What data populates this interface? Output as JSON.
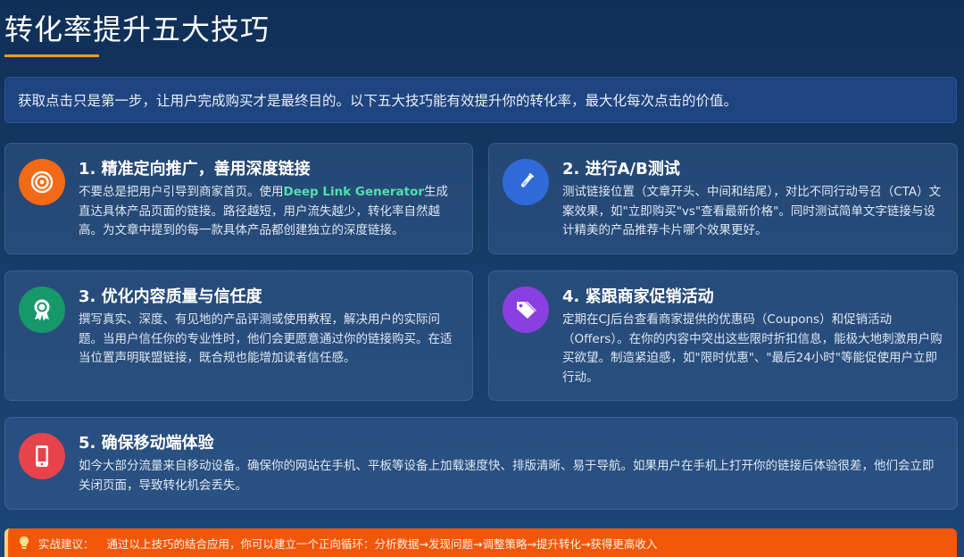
{
  "header": {
    "title": "转化率提升五大技巧"
  },
  "intro": "获取点击只是第一步，让用户完成购买才是最终目的。以下五大技巧能有效提升你的转化率，最大化每次点击的价值。",
  "colors": {
    "accent": "#f59a22",
    "tip_bar": "#f2560b",
    "highlight": "#4fe0b0"
  },
  "cards": [
    {
      "icon": "target-icon",
      "color": "#f26a16",
      "title": "1. 精准定向推广，善用深度链接",
      "body_pre": "不要总是把用户引导到商家首页。使用",
      "body_highlight": "Deep Link Generator",
      "body_post": "生成直达具体产品页面的链接。路径越短，用户流失越少，转化率自然越高。为文章中提到的每一款具体产品都创建独立的深度链接。"
    },
    {
      "icon": "flask-icon",
      "color": "#2f6bd8",
      "title": "2. 进行A/B测试",
      "body": "测试链接位置（文章开头、中间和结尾），对比不同行动号召（CTA）文案效果，如\"立即购买\"vs\"查看最新价格\"。同时测试简单文字链接与设计精美的产品推荐卡片哪个效果更好。"
    },
    {
      "icon": "award-icon",
      "color": "#17986a",
      "title": "3. 优化内容质量与信任度",
      "body": "撰写真实、深度、有见地的产品评测或使用教程，解决用户的实际问题。当用户信任你的专业性时，他们会更愿意通过你的链接购买。在适当位置声明联盟链接，既合规也能增加读者信任感。"
    },
    {
      "icon": "tags-icon",
      "color": "#8a3fe0",
      "title": "4. 紧跟商家促销活动",
      "body": "定期在CJ后台查看商家提供的优惠码（Coupons）和促销活动（Offers）。在你的内容中突出这些限时折扣信息，能极大地刺激用户购买欲望。制造紧迫感，如\"限时优惠\"、\"最后24小时\"等能促使用户立即行动。"
    },
    {
      "icon": "mobile-icon",
      "color": "#e6434a",
      "title": "5. 确保移动端体验",
      "body": "如今大部分流量来自移动设备。确保你的网站在手机、平板等设备上加载速度快、排版清晰、易于导航。如果用户在手机上打开你的链接后体验很差，他们会立即关闭页面，导致转化机会丢失。"
    }
  ],
  "tip": {
    "icon": "lightbulb-icon",
    "label": "实战建议：",
    "text": "通过以上技巧的结合应用，你可以建立一个正向循环：分析数据→发现问题→调整策略→提升转化→获得更高收入"
  }
}
